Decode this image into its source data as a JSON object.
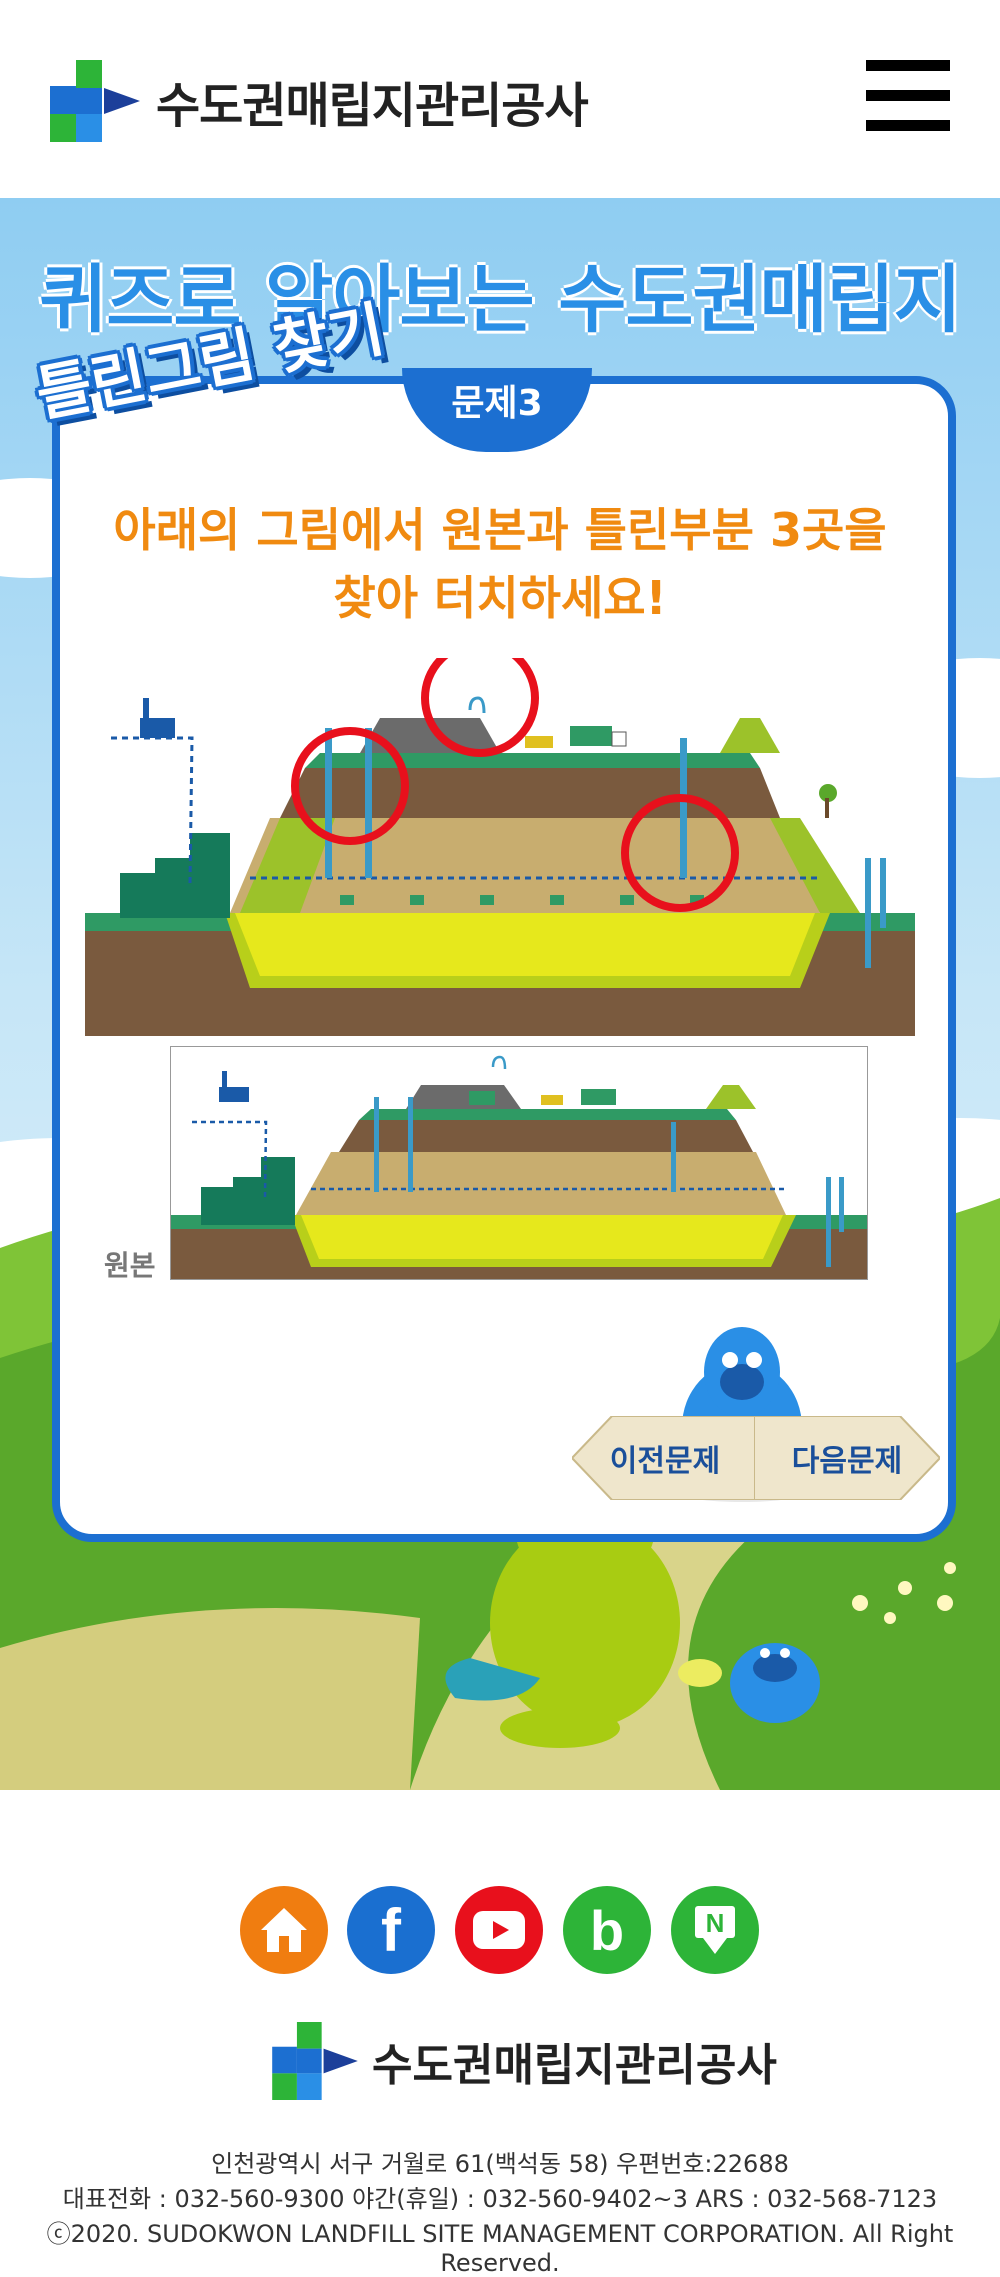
{
  "header": {
    "org_name": "수도권매립지관리공사",
    "menu_icon": "hamburger-menu-icon"
  },
  "quiz": {
    "title": "퀴즈로 알아보는 수도권매립지",
    "spot_label": "틀린그림 찾기",
    "question_badge": "문제3",
    "instruction_line1": "아래의 그림에서 원본과 틀린부분 3곳을",
    "instruction_line2": "찾아 터치하세요!",
    "original_label": "원본",
    "prev_button": "이전문제",
    "next_button": "다음문제",
    "found_marks": 3
  },
  "footer": {
    "social_icons": [
      {
        "name": "home-icon",
        "color": "#f07d10"
      },
      {
        "name": "facebook-icon",
        "color": "#1a6fd0",
        "glyph": "f"
      },
      {
        "name": "youtube-icon",
        "color": "#e8101c"
      },
      {
        "name": "blog-icon",
        "color": "#2db438",
        "glyph": "b"
      },
      {
        "name": "naver-post-icon",
        "color": "#2db438",
        "glyph": "N"
      }
    ],
    "org_name": "수도권매립지관리공사",
    "address": "인천광역시 서구 거월로 61(백석동 58) 우편번호:22688",
    "phones": "대표전화 : 032-560-9300  야간(휴일) : 032-560-9402~3  ARS : 032-568-7123",
    "copyright": "ⓒ2020. SUDOKWON LANDFILL SITE MANAGEMENT CORPORATION. All Right Reserved."
  }
}
